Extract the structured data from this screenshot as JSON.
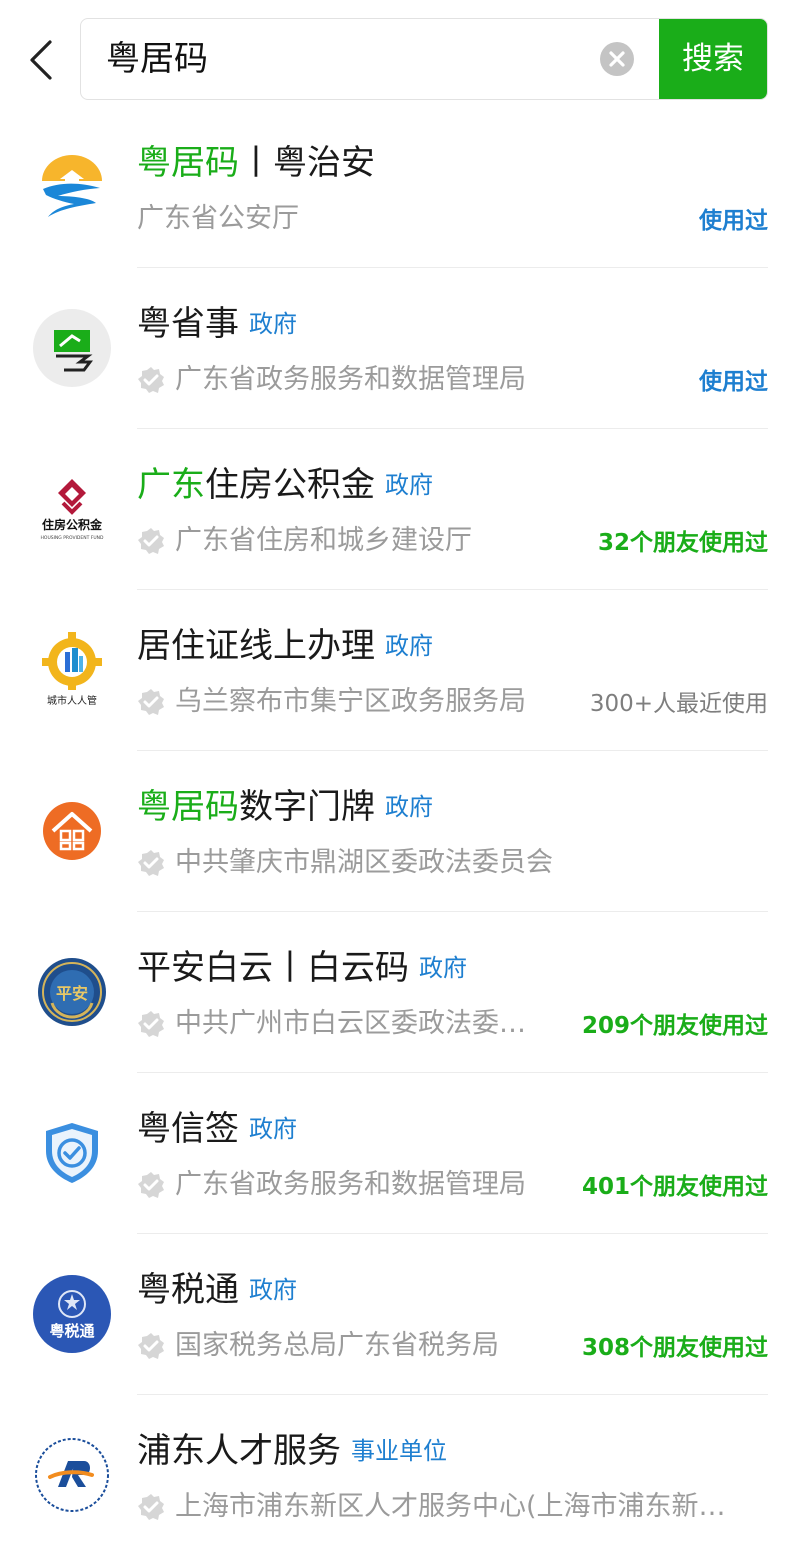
{
  "search": {
    "query": "粤居码",
    "button_label": "搜索"
  },
  "results": [
    {
      "title_hl": "粤居码",
      "title_rest": "丨粤治安",
      "tag": "",
      "subtitle": "广东省公安厅",
      "verified": false,
      "note": "使用过",
      "note_color": "blue",
      "logo": "mountain-river-icon"
    },
    {
      "title_hl": "",
      "title_rest": "粤省事",
      "tag": "政府",
      "subtitle": "广东省政务服务和数据管理局",
      "verified": true,
      "note": "使用过",
      "note_color": "blue",
      "logo": "yue-sheng-shi-icon"
    },
    {
      "title_hl": "广东",
      "title_rest": "住房公积金",
      "tag": "政府",
      "subtitle": "广东省住房和城乡建设厅",
      "verified": true,
      "note": "32个朋友使用过",
      "note_color": "green",
      "logo": "housing-fund-icon",
      "logo_text": "住房公积金",
      "logo_subtext": "HOUSING PROVIDENT FUND"
    },
    {
      "title_hl": "",
      "title_rest": "居住证线上办理",
      "tag": "政府",
      "subtitle": "乌兰察布市集宁区政务服务局",
      "verified": true,
      "note": "300+人最近使用",
      "note_color": "gray",
      "logo": "city-gear-icon",
      "logo_text": "城市人人管"
    },
    {
      "title_hl": "粤居码",
      "title_rest": "数字门牌",
      "tag": "政府",
      "subtitle": "中共肇庆市鼎湖区委政法委员会",
      "verified": true,
      "note": "",
      "note_color": "gray",
      "logo": "house-qr-icon"
    },
    {
      "title_hl": "",
      "title_rest": "平安白云丨白云码",
      "tag": "政府",
      "subtitle": "中共广州市白云区委政法委…",
      "verified": true,
      "note": "209个朋友使用过",
      "note_color": "green",
      "logo": "police-badge-icon",
      "logo_text": "平安"
    },
    {
      "title_hl": "",
      "title_rest": "粤信签",
      "tag": "政府",
      "subtitle": "广东省政务服务和数据管理局",
      "verified": true,
      "note": "401个朋友使用过",
      "note_color": "green",
      "logo": "shield-check-icon"
    },
    {
      "title_hl": "",
      "title_rest": "粤税通",
      "tag": "政府",
      "subtitle": "国家税务总局广东省税务局",
      "verified": true,
      "note": "308个朋友使用过",
      "note_color": "green",
      "logo": "tax-emblem-icon",
      "logo_text": "粤税通"
    },
    {
      "title_hl": "",
      "title_rest": "浦东人才服务",
      "tag": "事业单位",
      "subtitle": "上海市浦东新区人才服务中心(上海市浦东新…",
      "verified": true,
      "note": "",
      "note_color": "gray",
      "logo": "pudong-talent-icon"
    }
  ]
}
